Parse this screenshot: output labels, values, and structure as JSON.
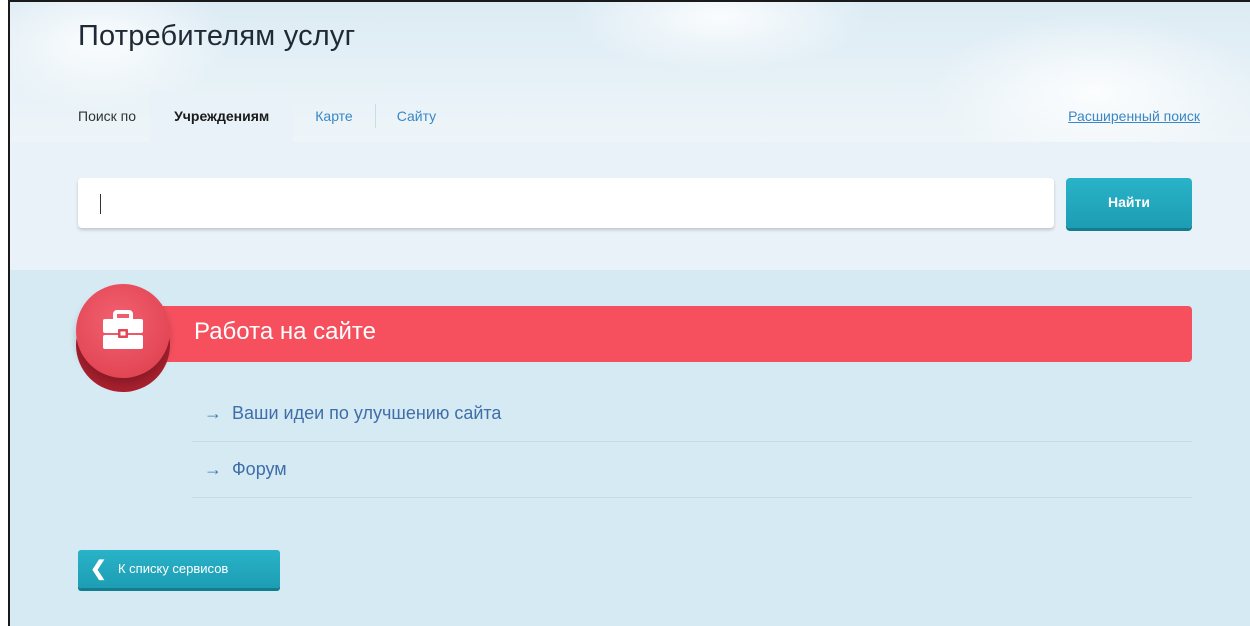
{
  "header": {
    "title": "Потребителям услуг",
    "tabs_prefix": "Поиск по",
    "tabs": [
      {
        "label": "Учреждениям",
        "active": true
      },
      {
        "label": "Карте",
        "active": false
      },
      {
        "label": "Сайту",
        "active": false
      }
    ],
    "advanced_search": "Расширенный поиск"
  },
  "search": {
    "value": "",
    "button_label": "Найти"
  },
  "section": {
    "title": "Работа на сайте",
    "icon": "briefcase-icon",
    "links": [
      {
        "arrow": "→",
        "label": "Ваши идеи по улучшению сайта"
      },
      {
        "arrow": "→",
        "label": "Форум"
      }
    ]
  },
  "back_button": {
    "label": "К списку сервисов",
    "chevron": "❮"
  },
  "colors": {
    "accent_red": "#f6505e",
    "accent_teal": "#22a8be",
    "link_blue": "#3a87c4"
  }
}
